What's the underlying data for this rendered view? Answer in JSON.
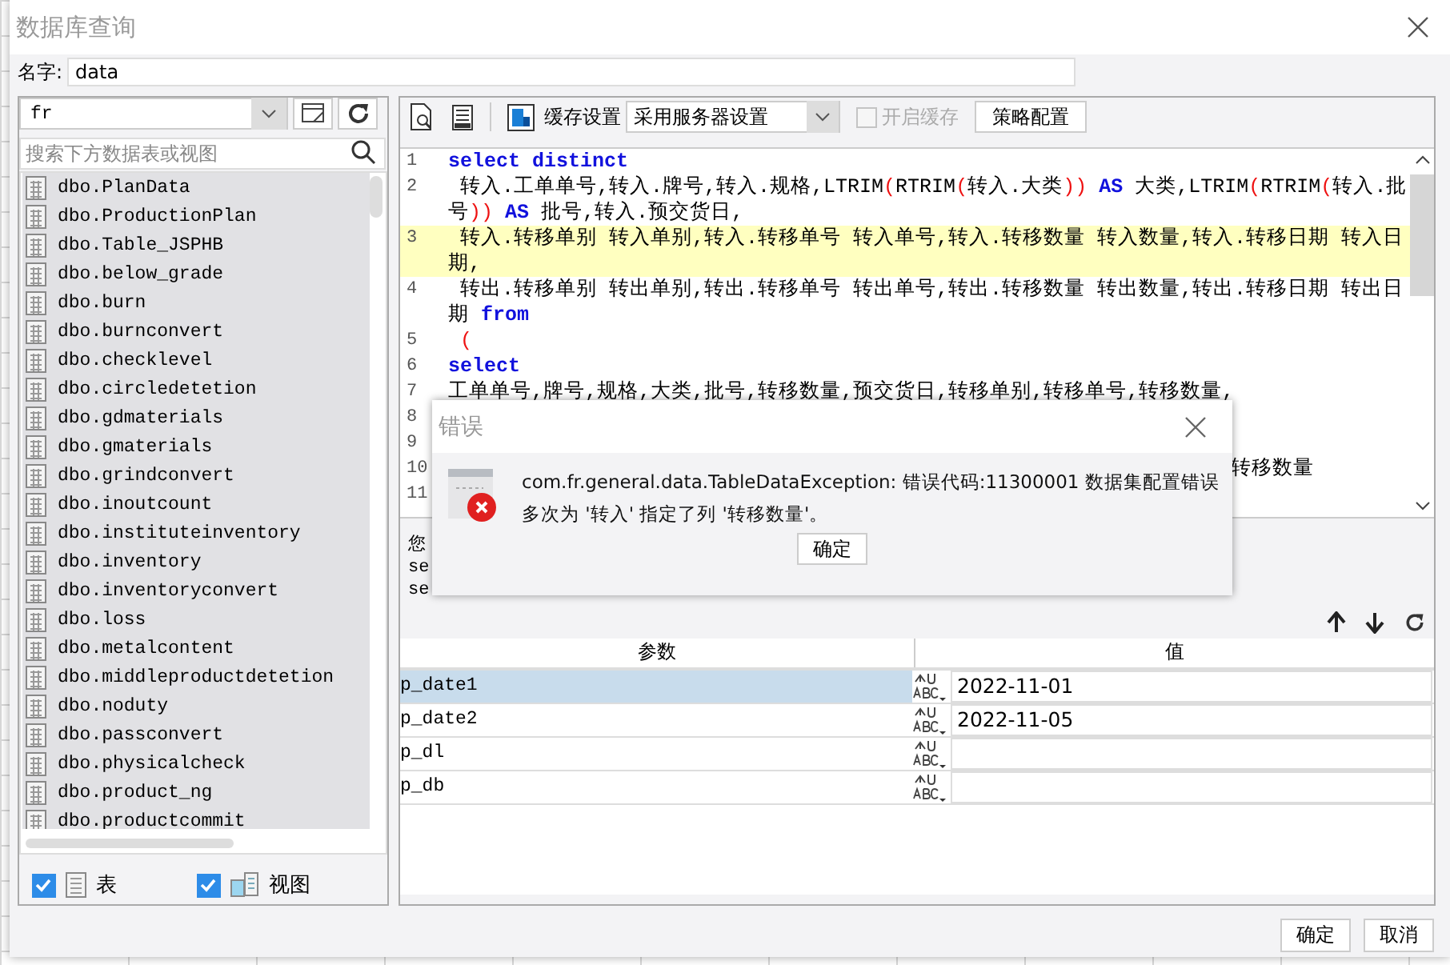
{
  "window": {
    "title": "数据库查询"
  },
  "name_field": {
    "label": "名字:",
    "value": "data"
  },
  "left_panel": {
    "connection": "fr",
    "search": {
      "placeholder": "搜索下方数据表或视图"
    },
    "tables": [
      "dbo.PlanData",
      "dbo.ProductionPlan",
      "dbo.Table_JSPHB",
      "dbo.below_grade",
      "dbo.burn",
      "dbo.burnconvert",
      "dbo.checklevel",
      "dbo.circledetetion",
      "dbo.gdmaterials",
      "dbo.gmaterials",
      "dbo.grindconvert",
      "dbo.inoutcount",
      "dbo.instituteinventory",
      "dbo.inventory",
      "dbo.inventoryconvert",
      "dbo.loss",
      "dbo.metalcontent",
      "dbo.middleproductdetetion",
      "dbo.noduty",
      "dbo.passconvert",
      "dbo.physicalcheck",
      "dbo.product_ng",
      "dbo.productcommit"
    ],
    "filters": [
      {
        "label": "表",
        "checked": true,
        "kind": "table"
      },
      {
        "label": "视图",
        "checked": true,
        "kind": "view"
      }
    ]
  },
  "toolbar": {
    "cache_label": "缓存设置",
    "cache_select": "采用服务器设置",
    "enable_cache": {
      "label": "开启缓存",
      "checked": false,
      "disabled": true
    },
    "policy_button": "策略配置"
  },
  "editor": {
    "lines": [
      {
        "number": "1",
        "highlighted": false,
        "segments": [
          {
            "kind": "kw",
            "text": "select distinct"
          }
        ]
      },
      {
        "number": "2",
        "highlighted": false,
        "segments": [
          {
            "kind": "text",
            "text": " 转入.工单单号,转入.牌号,转入.规格,LTRIM"
          },
          {
            "kind": "paren",
            "text": "("
          },
          {
            "kind": "text",
            "text": "RTRIM"
          },
          {
            "kind": "paren",
            "text": "("
          },
          {
            "kind": "text",
            "text": "转入.大类"
          },
          {
            "kind": "paren",
            "text": ")) "
          },
          {
            "kind": "kw",
            "text": "AS"
          },
          {
            "kind": "text",
            "text": " 大类,LTRIM"
          },
          {
            "kind": "paren",
            "text": "("
          },
          {
            "kind": "text",
            "text": "RTRIM"
          },
          {
            "kind": "paren",
            "text": "("
          },
          {
            "kind": "text",
            "text": "转入.批号"
          },
          {
            "kind": "paren",
            "text": ")) "
          },
          {
            "kind": "kw",
            "text": "AS"
          },
          {
            "kind": "text",
            "text": " 批号,转入.预交货日,"
          }
        ]
      },
      {
        "number": "3",
        "highlighted": true,
        "segments": [
          {
            "kind": "text",
            "text": " 转入.转移单别 转入单别,转入.转移单号 转入单号,转入.转移数量 转入数量,转入.转移日期 转入日期,"
          }
        ]
      },
      {
        "number": "4",
        "highlighted": false,
        "segments": [
          {
            "kind": "text",
            "text": " 转出.转移单别 转出单别,转出.转移单号 转出单号,转出.转移数量 转出数量,转出.转移日期 转出日期 "
          },
          {
            "kind": "kw",
            "text": "from"
          }
        ]
      },
      {
        "number": "5",
        "highlighted": false,
        "segments": [
          {
            "kind": "paren",
            "text": " ("
          }
        ]
      },
      {
        "number": "6",
        "highlighted": false,
        "segments": [
          {
            "kind": "kw",
            "text": "select"
          }
        ]
      },
      {
        "number": "7",
        "highlighted": false,
        "segments": [
          {
            "kind": "text",
            "text": "工单单号,牌号,规格,大类,批号,转移数量,预交货日,转移单别,转移单号,转移数量,"
          }
        ]
      },
      {
        "number": "8",
        "highlighted": false
      },
      {
        "number": "9",
        "highlighted": false
      },
      {
        "number": "10",
        "highlighted": false,
        "segments": [
          {
            "kind": "covered",
            "text": "转移数量"
          }
        ]
      },
      {
        "number": "11",
        "highlighted": false
      }
    ]
  },
  "hint_lines": [
    "您",
    "se",
    "se"
  ],
  "params": {
    "columns": [
      "参数",
      "值"
    ],
    "rows": [
      {
        "name": "p_date1",
        "value": "2022-11-01",
        "selected": true
      },
      {
        "name": "p_date2",
        "value": "2022-11-05",
        "selected": false
      },
      {
        "name": "p_dl",
        "value": "",
        "selected": false
      },
      {
        "name": "p_db",
        "value": "",
        "selected": false
      }
    ]
  },
  "buttons": [
    "确定",
    "取消"
  ],
  "error_dialog": {
    "title": "错误",
    "message": "com.fr.general.data.TableDataException: 错误代码:11300001 数据集配置错误多次为 '转入' 指定了列 '转移数量'。",
    "button": "确定"
  }
}
